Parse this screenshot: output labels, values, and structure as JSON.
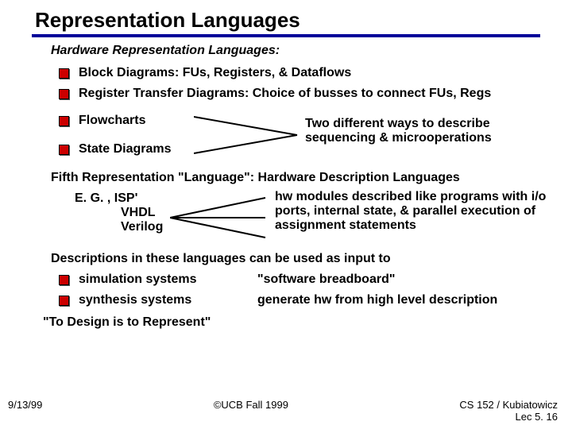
{
  "title": "Representation Languages",
  "subtitle": "Hardware Representation Languages:",
  "bullets_top": [
    "Block Diagrams:  FUs, Registers, & Dataflows",
    "Register Transfer Diagrams:  Choice of busses to connect FUs, Regs"
  ],
  "pair": {
    "left1": "Flowcharts",
    "left2": "State Diagrams",
    "right": "Two different ways to describe sequencing & microoperations"
  },
  "fifth": "Fifth Representation \"Language\":  Hardware Description Languages",
  "eg": {
    "label": "E. G. ,  ISP'",
    "l2": "VHDL",
    "l3": "Verilog",
    "right": "hw modules described like programs with i/o ports, internal state, & parallel execution of assignment statements"
  },
  "desc": "Descriptions in these languages can be used as input to",
  "sim": {
    "left": "simulation systems",
    "right": "\"software breadboard\""
  },
  "syn": {
    "left": "synthesis systems",
    "right": "generate hw from high level description"
  },
  "quote": "\"To Design is to Represent\"",
  "footer": {
    "date": "9/13/99",
    "center": "©UCB Fall 1999",
    "right": "CS 152 / Kubiatowicz\nLec 5. 16"
  }
}
